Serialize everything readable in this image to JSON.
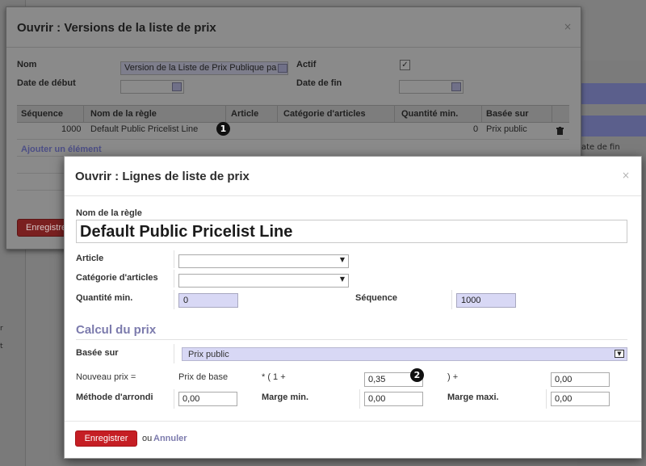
{
  "background": {
    "right_label": "ate de fin",
    "left_marks": [
      "r",
      "t"
    ]
  },
  "dialog1": {
    "title": "Ouvrir : Versions de la liste de prix",
    "close_glyph": "×",
    "fields": {
      "name_label": "Nom",
      "name_value": "Version de la Liste de Prix Publique pa",
      "start_label": "Date de début",
      "active_label": "Actif",
      "active_checked": true,
      "end_label": "Date de fin"
    },
    "table": {
      "headers": [
        "Séquence",
        "Nom de la règle",
        "Article",
        "Catégorie d'articles",
        "Quantité min.",
        "Basée sur"
      ],
      "rows": [
        {
          "sequence": "1000",
          "name": "Default Public Pricelist Line",
          "article": "",
          "category": "",
          "min_qty": "0",
          "based_on": "Prix public"
        }
      ],
      "add_item": "Ajouter un élément"
    },
    "save_label": "Enregistrer"
  },
  "dialog2": {
    "title": "Ouvrir : Lignes de liste de prix",
    "close_glyph": "×",
    "rule_name_label": "Nom de la règle",
    "rule_name_value": "Default Public Pricelist Line",
    "article_label": "Article",
    "category_label": "Catégorie d'articles",
    "min_qty_label": "Quantité min.",
    "min_qty_value": "0",
    "sequence_label": "Séquence",
    "sequence_value": "1000",
    "section_title": "Calcul du prix",
    "based_on_label": "Basée sur",
    "based_on_value": "Prix public",
    "new_price_label": "Nouveau prix =",
    "base_price_text": "Prix de base",
    "multiplier_text": "* ( 1 +",
    "discount_value": "0,35",
    "plus_text": ") +",
    "surcharge_value": "0,00",
    "rounding_label": "Méthode d'arrondi",
    "rounding_value": "0,00",
    "min_margin_label": "Marge min.",
    "min_margin_value": "0,00",
    "max_margin_label": "Marge maxi.",
    "max_margin_value": "0,00",
    "save_label": "Enregistrer",
    "or_text": "ou",
    "cancel_label": "Annuler"
  },
  "annotations": {
    "badge1": "1",
    "badge2": "2"
  },
  "colors": {
    "accent": "#7c7bad",
    "primary_button": "#c51e24",
    "readonly_field": "#d8d8f5"
  }
}
